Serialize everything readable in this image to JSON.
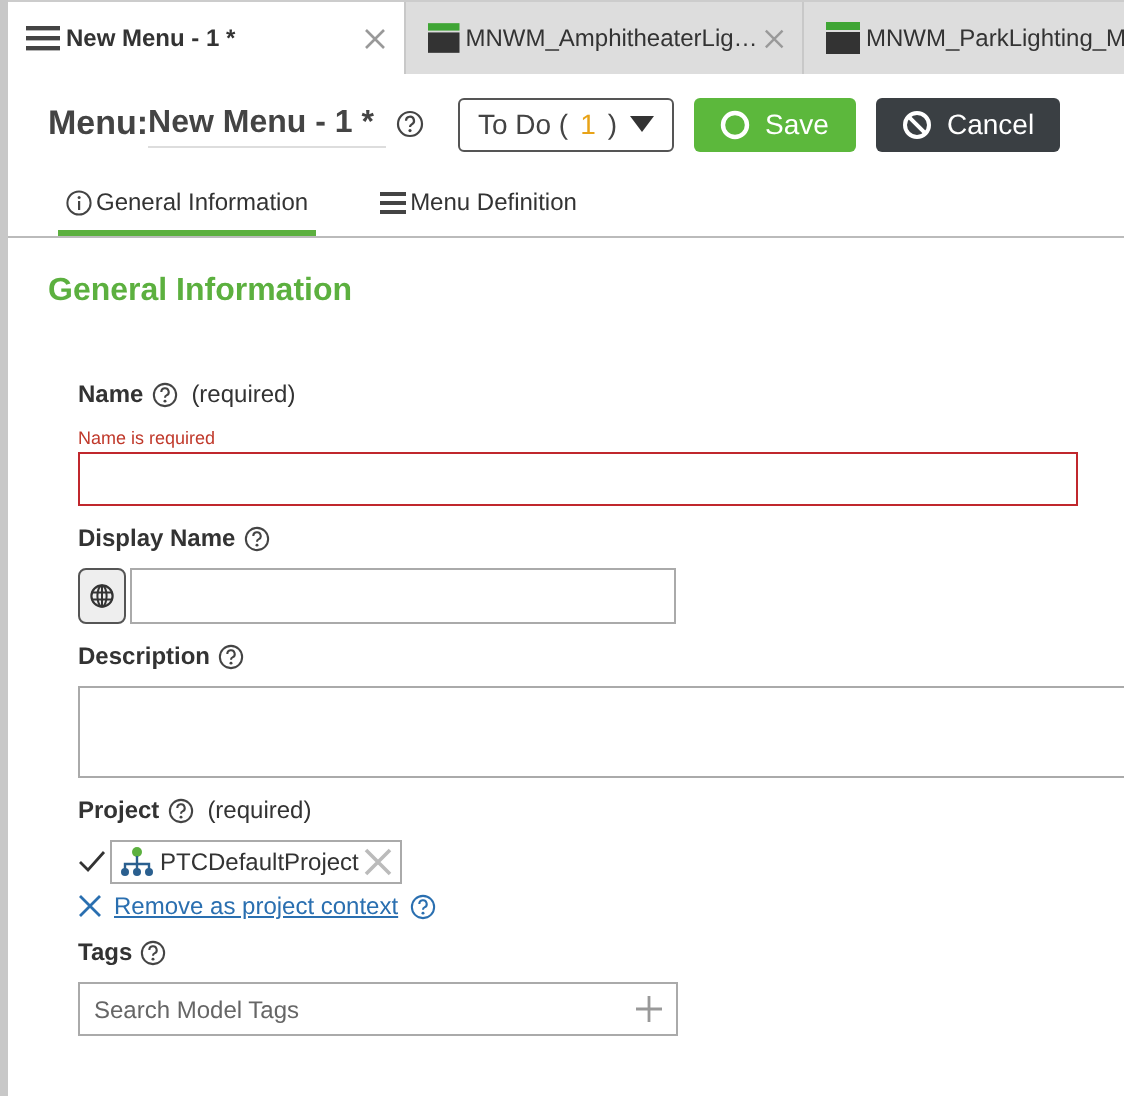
{
  "tabs": [
    {
      "label": "New Menu - 1 *",
      "kind": "menu",
      "selected": true,
      "closable": true
    },
    {
      "label": "MNWM_AmphitheaterLig…",
      "kind": "model",
      "selected": false,
      "closable": true
    },
    {
      "label": "MNWM_ParkLighting_M",
      "kind": "model",
      "selected": false,
      "closable": false
    }
  ],
  "header": {
    "prefix": "Menu:",
    "name": "New Menu - 1 *",
    "todo_label": "To Do",
    "todo_open": "(",
    "todo_count": "1",
    "todo_close": ")",
    "save": "Save",
    "cancel": "Cancel"
  },
  "subtabs": [
    {
      "label": "General Information",
      "kind": "info",
      "selected": true
    },
    {
      "label": "Menu Definition",
      "kind": "list",
      "selected": false
    }
  ],
  "section_title": "General Information",
  "fields": [
    {
      "kind": "text",
      "label": "Name",
      "required": "(required)",
      "error": "Name is required"
    },
    {
      "kind": "localized",
      "label": "Display Name"
    },
    {
      "kind": "textarea",
      "label": "Description"
    },
    {
      "kind": "project",
      "label": "Project",
      "required": "(required)",
      "value": "PTCDefaultProject",
      "link": "Remove as project context"
    },
    {
      "kind": "tags",
      "label": "Tags",
      "placeholder": "Search Model Tags"
    }
  ]
}
